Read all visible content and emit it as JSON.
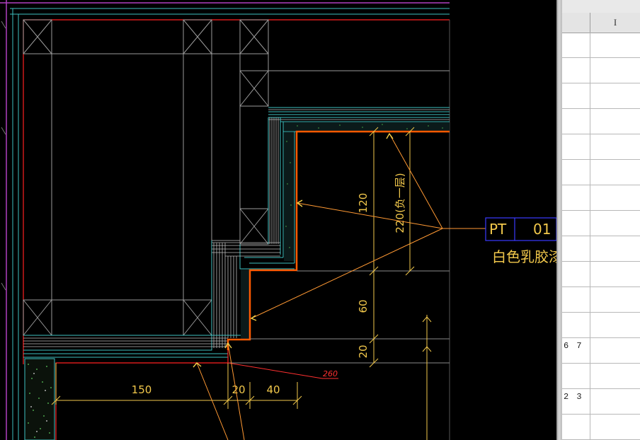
{
  "drawing": {
    "leader_tag": {
      "code": "PT",
      "number": "01",
      "description": "白色乳胶漆"
    },
    "dimensions": {
      "d150": "150",
      "d20_bottom": "20",
      "d40": "40",
      "v120": "120",
      "v220": "220(负一层)",
      "v60": "60",
      "v20": "20"
    },
    "red_callout": "260",
    "colors": {
      "background": "#000000",
      "wall_line": "#ff2020",
      "finish_line": "#ff5a00",
      "dimension": "#f2c84b",
      "leader": "#ff9933",
      "hatch": "#7fdfdf",
      "outer_border": "#b040c0",
      "tag_box": "#3a3aff"
    }
  },
  "spreadsheet": {
    "column_header": "I",
    "rows": [
      {
        "a": ""
      },
      {
        "a": ""
      },
      {
        "a": ""
      },
      {
        "a": ""
      },
      {
        "a": ""
      },
      {
        "a": ""
      },
      {
        "a": ""
      },
      {
        "a": ""
      },
      {
        "a": ""
      },
      {
        "a": ""
      },
      {
        "a": ""
      },
      {
        "a": ""
      },
      {
        "a": "6 7"
      },
      {
        "a": ""
      },
      {
        "a": "2 3"
      },
      {
        "a": ""
      }
    ]
  }
}
